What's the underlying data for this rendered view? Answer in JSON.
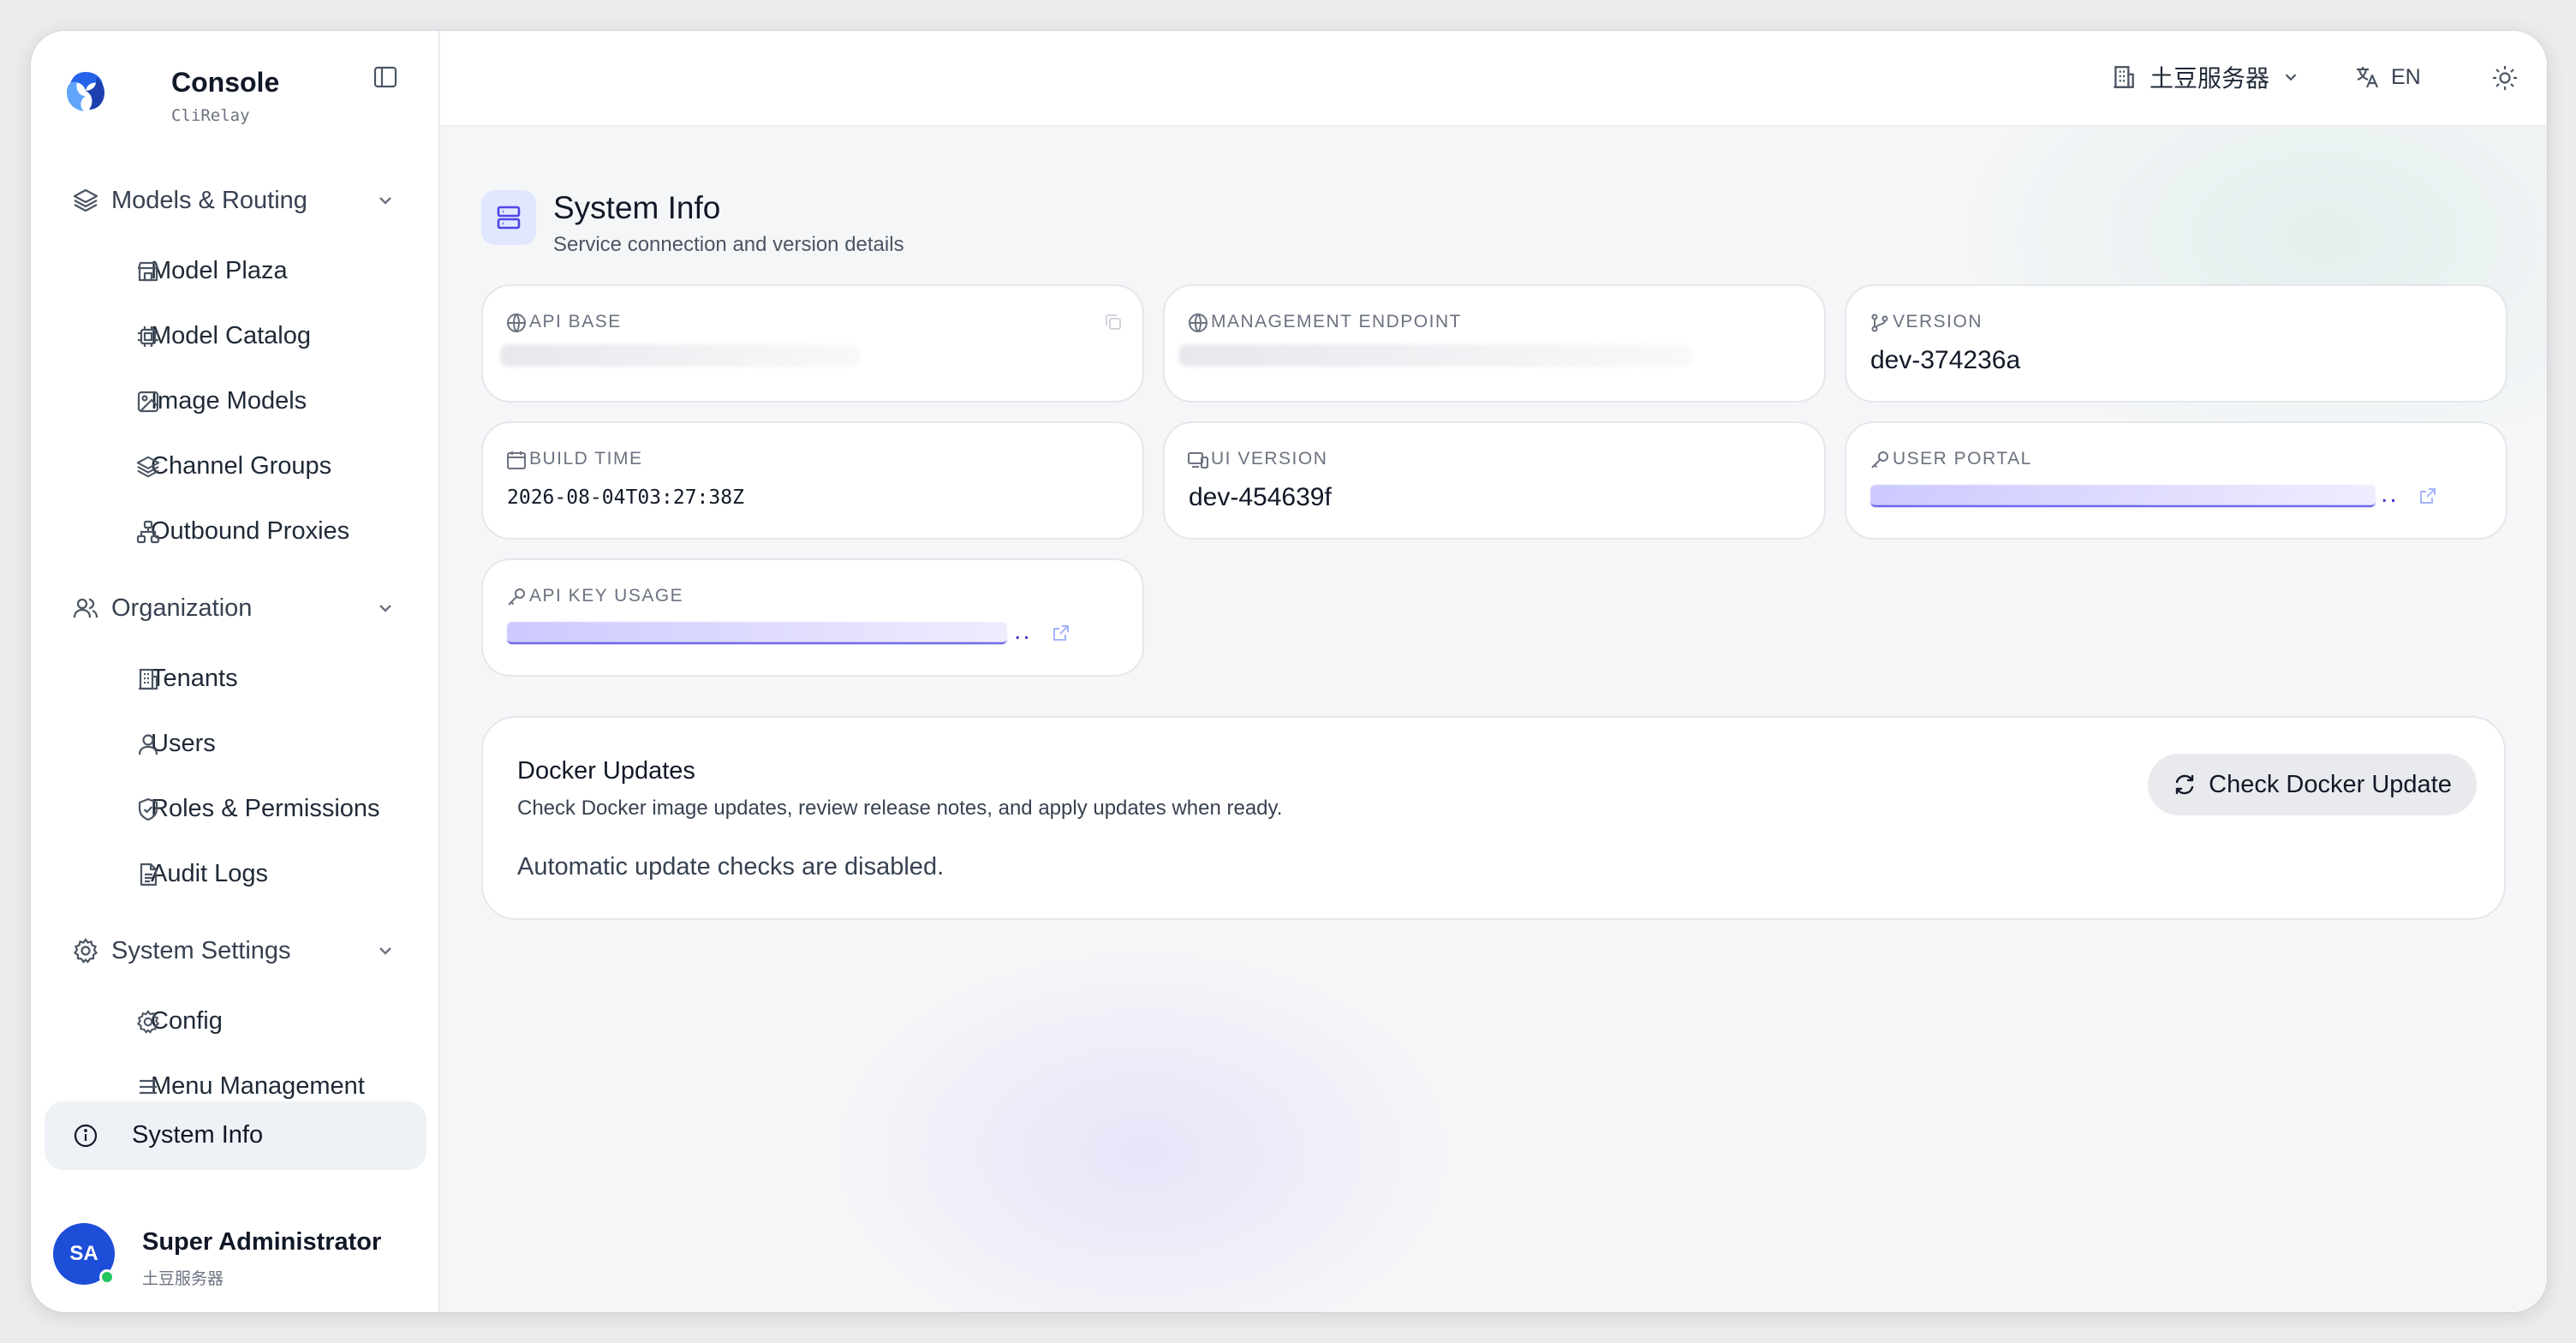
{
  "app": {
    "title": "Console",
    "subtitle": "CliRelay"
  },
  "sidebar": {
    "groups": [
      {
        "label": "Models & Routing",
        "items": [
          {
            "label": "Model Plaza",
            "icon": "store-icon"
          },
          {
            "label": "Model Catalog",
            "icon": "chip-icon"
          },
          {
            "label": "Image Models",
            "icon": "image-icon"
          },
          {
            "label": "Channel Groups",
            "icon": "layers-icon"
          },
          {
            "label": "Outbound Proxies",
            "icon": "network-icon"
          }
        ]
      },
      {
        "label": "Organization",
        "items": [
          {
            "label": "Tenants",
            "icon": "building-icon"
          },
          {
            "label": "Users",
            "icon": "user-icon"
          },
          {
            "label": "Roles & Permissions",
            "icon": "shield-icon"
          },
          {
            "label": "Audit Logs",
            "icon": "document-icon"
          }
        ]
      },
      {
        "label": "System Settings",
        "items": [
          {
            "label": "Config",
            "icon": "gear-icon"
          },
          {
            "label": "Menu Management",
            "icon": "menu-icon"
          }
        ]
      }
    ],
    "active_item": "System Info"
  },
  "user": {
    "initials": "SA",
    "name": "Super Administrator",
    "org": "土豆服务器",
    "status_color": "#22c55e"
  },
  "topbar": {
    "tenant": "土豆服务器",
    "language": "EN"
  },
  "page": {
    "title": "System Info",
    "subtitle": "Service connection and version details"
  },
  "cards": {
    "api_base": {
      "label": "API BASE"
    },
    "management_endpoint": {
      "label": "MANAGEMENT ENDPOINT"
    },
    "version": {
      "label": "VERSION",
      "value": "dev-374236a"
    },
    "build_time": {
      "label": "BUILD TIME",
      "value": "2026-08-04T03:27:38Z"
    },
    "ui_version": {
      "label": "UI VERSION",
      "value": "dev-454639f"
    },
    "user_portal": {
      "label": "USER PORTAL",
      "ellipsis": ".."
    },
    "api_key_usage": {
      "label": "API KEY USAGE",
      "ellipsis": ".."
    }
  },
  "docker": {
    "title": "Docker Updates",
    "description": "Check Docker image updates, review release notes, and apply updates when ready.",
    "status": "Automatic update checks are disabled.",
    "button_label": "Check Docker Update"
  },
  "colors": {
    "accent": "#4f46e5",
    "active_bg": "#eef1f6",
    "avatar": "#1d4ed8"
  }
}
